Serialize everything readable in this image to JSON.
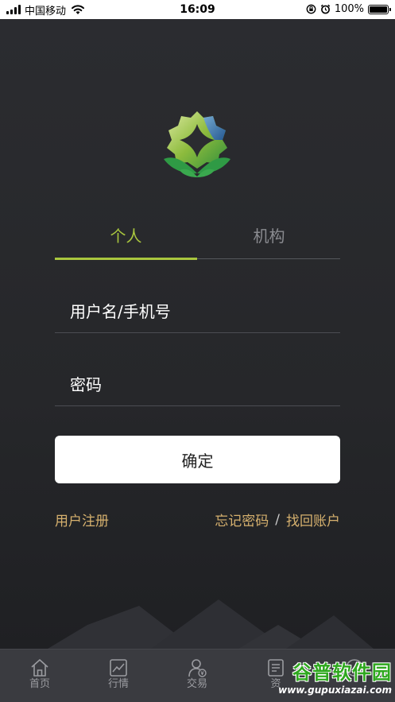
{
  "status_bar": {
    "carrier": "中国移动",
    "time": "16:09",
    "battery": "100%"
  },
  "tabs": [
    {
      "label": "个人",
      "active": true
    },
    {
      "label": "机构",
      "active": false
    }
  ],
  "form": {
    "username_placeholder": "用户名/手机号",
    "password_placeholder": "密码",
    "username_value": "",
    "password_value": "",
    "confirm_label": "确定"
  },
  "links": {
    "register": "用户注册",
    "forgot_password": "忘记密码",
    "separator": "/",
    "recover_account": "找回账户"
  },
  "bottom_nav": [
    {
      "label": "首页",
      "icon": "home-icon"
    },
    {
      "label": "行情",
      "icon": "chart-icon"
    },
    {
      "label": "交易",
      "icon": "trade-user-icon"
    },
    {
      "label": "资",
      "icon": "assets-icon"
    },
    {
      "label": "",
      "icon": "mine-icon"
    }
  ],
  "watermark": {
    "title": "谷普软件园",
    "url": "www.gupuxiazai.com"
  },
  "colors": {
    "accent": "#a9c63e",
    "link": "#d6b16e",
    "background": "#28292d",
    "nav_background": "#3a3b40"
  }
}
